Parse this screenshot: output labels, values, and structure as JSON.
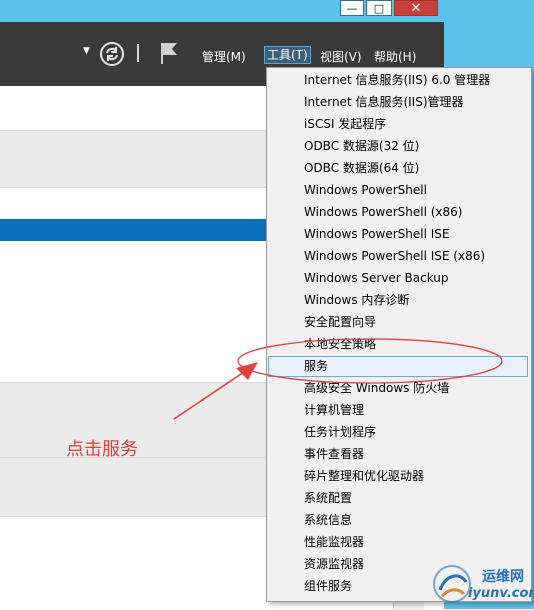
{
  "window": {
    "min_glyph": "—",
    "max_glyph": "□",
    "close_glyph": "✕"
  },
  "menubar": {
    "manage": "管理(M)",
    "tools": "工具(T)",
    "view": "视图(V)",
    "help": "帮助(H)"
  },
  "tools_menu": {
    "items": [
      "Internet 信息服务(IIS) 6.0 管理器",
      "Internet 信息服务(IIS)管理器",
      "iSCSI 发起程序",
      "ODBC 数据源(32 位)",
      "ODBC 数据源(64 位)",
      "Windows PowerShell",
      "Windows PowerShell (x86)",
      "Windows PowerShell ISE",
      "Windows PowerShell ISE (x86)",
      "Windows Server Backup",
      "Windows 内存诊断",
      "安全配置向导",
      "本地安全策略",
      "服务",
      "高级安全 Windows 防火墙",
      "计算机管理",
      "任务计划程序",
      "事件查看器",
      "碎片整理和优化驱动器",
      "系统配置",
      "系统信息",
      "性能监视器",
      "资源监视器",
      "组件服务"
    ],
    "highlighted_item": "服务"
  },
  "annotation": {
    "text": "点击服务",
    "color": "#e0423c"
  },
  "watermark": {
    "cn": "运维网",
    "en": "iyunv.com"
  },
  "colors": {
    "sky": "#5bc4ea",
    "command_bar": "#3a3a3a",
    "selection": "#0a6fbd",
    "menu_bg": "#f0f0f0"
  },
  "icons": [
    "dropdown-arrow-icon",
    "refresh-icon",
    "flag-icon",
    "minimize-icon",
    "maximize-icon",
    "close-icon"
  ]
}
